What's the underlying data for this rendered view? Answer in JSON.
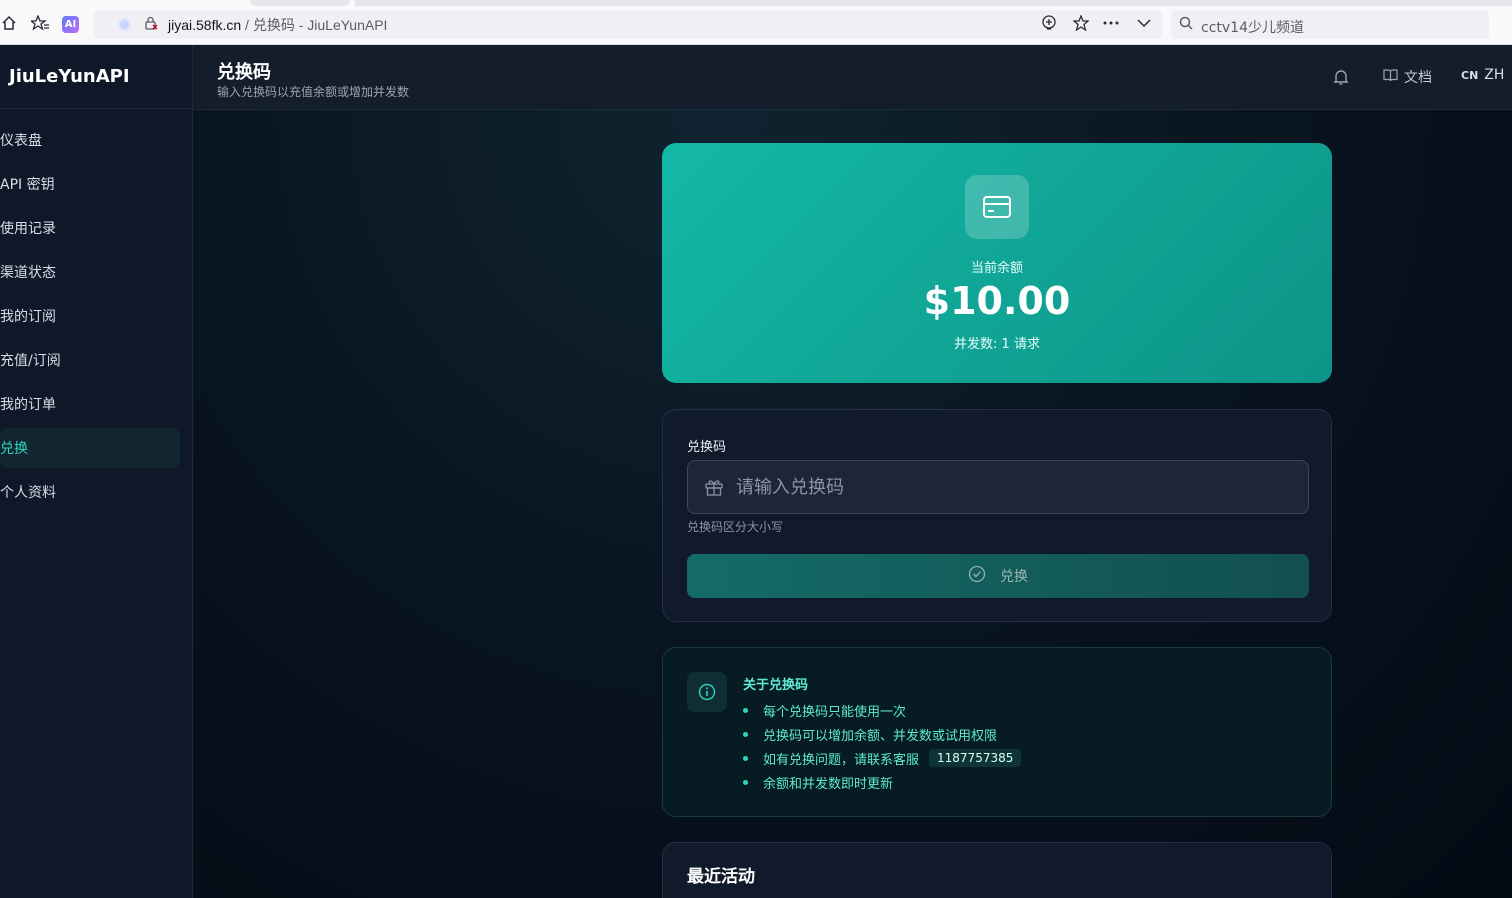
{
  "browser": {
    "url_domain": "jiyai.58fk.cn",
    "url_rest": " / 兑换码 - JiuLeYunAPI",
    "ai_badge": "AI",
    "search_text": "cctv14少儿频道"
  },
  "sidebar": {
    "brand": "JiuLeYunAPI",
    "items": [
      {
        "label": "仪表盘"
      },
      {
        "label": "API 密钥"
      },
      {
        "label": "使用记录"
      },
      {
        "label": "渠道状态"
      },
      {
        "label": "我的订阅"
      },
      {
        "label": "充值/订阅"
      },
      {
        "label": "我的订单"
      },
      {
        "label": "兑换",
        "active": true
      },
      {
        "label": "个人资料"
      }
    ]
  },
  "header": {
    "title": "兑换码",
    "subtitle": "输入兑换码以充值余额或增加并发数",
    "docs_label": "文档",
    "lang_flag": "CN",
    "lang_label": "ZH"
  },
  "balance": {
    "label": "当前余额",
    "value": "$10.00",
    "concurrency": "并发数: 1 请求"
  },
  "redeem": {
    "field_label": "兑换码",
    "placeholder": "请输入兑换码",
    "hint": "兑换码区分大小写",
    "button_label": "兑换"
  },
  "info": {
    "title": "关于兑换码",
    "items": [
      "每个兑换码只能使用一次",
      "兑换码可以增加余额、并发数或试用权限",
      "如有兑换问题，请联系客服",
      "余额和并发数即时更新"
    ],
    "contact": "1187757385"
  },
  "recent": {
    "title": "最近活动"
  },
  "colors": {
    "accent": "#14b8a6",
    "accent_text": "#5eead4",
    "sidebar_bg": "#0e1828",
    "card_bg": "#111a2a"
  }
}
